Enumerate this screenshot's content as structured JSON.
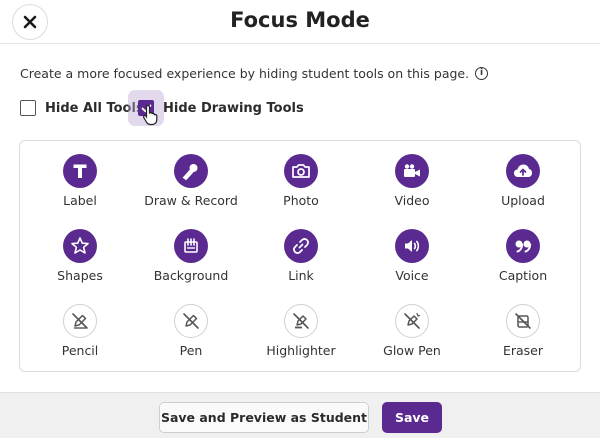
{
  "header": {
    "title": "Focus Mode",
    "close_icon": "close-icon"
  },
  "description": {
    "text": "Create a more focused experience by hiding student tools on this page.",
    "info_icon": "info-icon"
  },
  "options": {
    "hide_all": {
      "label": "Hide All Tools",
      "checked": false
    },
    "hide_drawing": {
      "label": "Hide Drawing Tools",
      "checked": true
    }
  },
  "tools": [
    {
      "label": "Label",
      "icon": "label-t-icon",
      "enabled": true
    },
    {
      "label": "Draw & Record",
      "icon": "microphone-icon",
      "enabled": true
    },
    {
      "label": "Photo",
      "icon": "camera-icon",
      "enabled": true
    },
    {
      "label": "Video",
      "icon": "video-camera-icon",
      "enabled": true
    },
    {
      "label": "Upload",
      "icon": "cloud-upload-icon",
      "enabled": true
    },
    {
      "label": "Shapes",
      "icon": "shapes-icon",
      "enabled": true
    },
    {
      "label": "Background",
      "icon": "background-icon",
      "enabled": true
    },
    {
      "label": "Link",
      "icon": "link-icon",
      "enabled": true
    },
    {
      "label": "Voice",
      "icon": "speaker-icon",
      "enabled": true
    },
    {
      "label": "Caption",
      "icon": "quote-icon",
      "enabled": true
    },
    {
      "label": "Pencil",
      "icon": "pencil-off-icon",
      "enabled": false
    },
    {
      "label": "Pen",
      "icon": "pen-off-icon",
      "enabled": false
    },
    {
      "label": "Highlighter",
      "icon": "highlighter-off-icon",
      "enabled": false
    },
    {
      "label": "Glow Pen",
      "icon": "glow-pen-off-icon",
      "enabled": false
    },
    {
      "label": "Eraser",
      "icon": "eraser-off-icon",
      "enabled": false
    }
  ],
  "footer": {
    "preview_label": "Save and Preview as Student",
    "save_label": "Save"
  },
  "colors": {
    "accent": "#5a2a91",
    "disabled_icon": "#555555"
  }
}
